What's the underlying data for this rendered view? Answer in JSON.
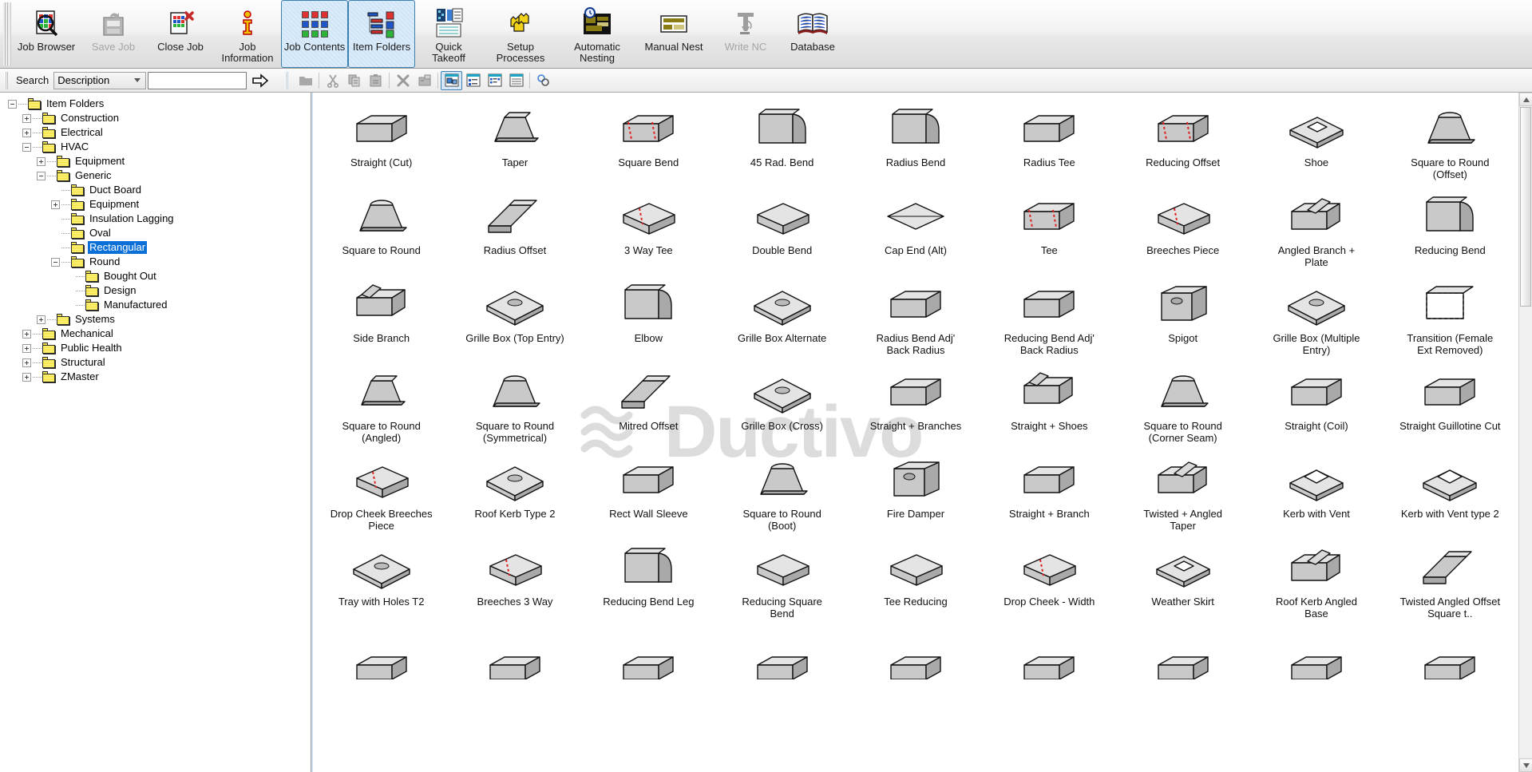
{
  "ribbon": {
    "buttons": [
      {
        "label": "Job Browser",
        "icon": "job-browser-icon",
        "state": "normal"
      },
      {
        "label": "Save Job",
        "icon": "save-job-icon",
        "state": "disabled"
      },
      {
        "label": "Close Job",
        "icon": "close-job-icon",
        "state": "normal"
      },
      {
        "label": "Job\nInformation",
        "icon": "job-information-icon",
        "state": "normal"
      },
      {
        "label": "Job Contents",
        "icon": "job-contents-icon",
        "state": "checked"
      },
      {
        "label": "Item Folders",
        "icon": "item-folders-icon",
        "state": "checked"
      },
      {
        "label": "Quick\nTakeoff",
        "icon": "quick-takeoff-icon",
        "state": "normal"
      },
      {
        "label": "Setup\nProcesses",
        "icon": "setup-processes-icon",
        "state": "normal"
      },
      {
        "label": "Automatic\nNesting",
        "icon": "automatic-nesting-icon",
        "state": "normal"
      },
      {
        "label": "Manual Nest",
        "icon": "manual-nest-icon",
        "state": "normal"
      },
      {
        "label": "Write NC",
        "icon": "write-nc-icon",
        "state": "disabled"
      },
      {
        "label": "Database",
        "icon": "database-icon",
        "state": "normal"
      }
    ]
  },
  "search": {
    "label": "Search",
    "field_selected": "Description",
    "field_options": [
      "Description"
    ],
    "value": "",
    "placeholder": "",
    "go_icon": "arrow-right-icon"
  },
  "toolbar2": {
    "buttons": [
      {
        "icon": "folder-icon",
        "state": "normal"
      },
      {
        "icon": "cut-icon",
        "state": "normal"
      },
      {
        "icon": "copy-icon",
        "state": "normal"
      },
      {
        "icon": "paste-icon",
        "state": "normal"
      },
      {
        "icon": "delete-icon",
        "state": "normal"
      },
      {
        "icon": "properties-icon",
        "state": "normal"
      },
      {
        "icon": "view-large-icons-icon",
        "state": "checked"
      },
      {
        "icon": "view-small-icons-icon",
        "state": "normal"
      },
      {
        "icon": "view-list-icon",
        "state": "normal"
      },
      {
        "icon": "view-details-icon",
        "state": "normal"
      },
      {
        "icon": "view-options-icon",
        "state": "normal"
      }
    ]
  },
  "tree": {
    "root_label": "Item Folders",
    "selected": "Rectangular",
    "nodes": [
      {
        "label": "Item Folders",
        "depth": 0,
        "toggle": "minus"
      },
      {
        "label": "Construction",
        "depth": 1,
        "toggle": "plus"
      },
      {
        "label": "Electrical",
        "depth": 1,
        "toggle": "plus"
      },
      {
        "label": "HVAC",
        "depth": 1,
        "toggle": "minus"
      },
      {
        "label": "Equipment",
        "depth": 2,
        "toggle": "plus"
      },
      {
        "label": "Generic",
        "depth": 2,
        "toggle": "minus"
      },
      {
        "label": "Duct Board",
        "depth": 3,
        "toggle": "none"
      },
      {
        "label": "Equipment",
        "depth": 3,
        "toggle": "plus"
      },
      {
        "label": "Insulation Lagging",
        "depth": 3,
        "toggle": "none"
      },
      {
        "label": "Oval",
        "depth": 3,
        "toggle": "none"
      },
      {
        "label": "Rectangular",
        "depth": 3,
        "toggle": "none",
        "selected": true
      },
      {
        "label": "Round",
        "depth": 3,
        "toggle": "minus"
      },
      {
        "label": "Bought Out",
        "depth": 4,
        "toggle": "none"
      },
      {
        "label": "Design",
        "depth": 4,
        "toggle": "none"
      },
      {
        "label": "Manufactured",
        "depth": 4,
        "toggle": "none"
      },
      {
        "label": "Systems",
        "depth": 2,
        "toggle": "plus"
      },
      {
        "label": "Mechanical",
        "depth": 1,
        "toggle": "plus"
      },
      {
        "label": "Public Health",
        "depth": 1,
        "toggle": "plus"
      },
      {
        "label": "Structural",
        "depth": 1,
        "toggle": "plus"
      },
      {
        "label": "ZMaster",
        "depth": 1,
        "toggle": "plus"
      }
    ]
  },
  "watermark": {
    "text": "Ductivo",
    "icon": "wave-lines-icon"
  },
  "items": [
    {
      "label": "Straight (Cut)",
      "shape": "box"
    },
    {
      "label": "Taper",
      "shape": "taper"
    },
    {
      "label": "Square Bend",
      "shape": "box-seam"
    },
    {
      "label": "45 Rad. Bend",
      "shape": "radbend"
    },
    {
      "label": "Radius Bend",
      "shape": "radbend2"
    },
    {
      "label": "Radius Tee",
      "shape": "box"
    },
    {
      "label": "Reducing Offset",
      "shape": "box-seam"
    },
    {
      "label": "Shoe",
      "shape": "shoe"
    },
    {
      "label": "Square to Round (Offset)",
      "shape": "s2r"
    },
    {
      "label": "Square to Round",
      "shape": "s2r"
    },
    {
      "label": "Radius Offset",
      "shape": "offset"
    },
    {
      "label": "3 Way Tee",
      "shape": "tee3"
    },
    {
      "label": "Double Bend",
      "shape": "dbend"
    },
    {
      "label": "Cap End (Alt)",
      "shape": "cap"
    },
    {
      "label": "Tee",
      "shape": "box-seam"
    },
    {
      "label": "Breeches Piece",
      "shape": "breeches"
    },
    {
      "label": "Angled Branch + Plate",
      "shape": "angbr"
    },
    {
      "label": "Reducing Bend",
      "shape": "rbend"
    },
    {
      "label": "Side Branch",
      "shape": "sidebr"
    },
    {
      "label": "Grille Box (Top Entry)",
      "shape": "gbox"
    },
    {
      "label": "Elbow",
      "shape": "elbow"
    },
    {
      "label": "Grille Box Alternate",
      "shape": "gboxalt"
    },
    {
      "label": "Radius Bend Adj' Back Radius",
      "shape": "box"
    },
    {
      "label": "Reducing Bend Adj' Back Radius",
      "shape": "box"
    },
    {
      "label": "Spigot",
      "shape": "spigot"
    },
    {
      "label": "Grille Box (Multiple Entry)",
      "shape": "gboxm"
    },
    {
      "label": "Transition (Female Ext Removed)",
      "shape": "trans"
    },
    {
      "label": "Square to Round (Angled)",
      "shape": "s2ra"
    },
    {
      "label": "Square to Round (Symmetrical)",
      "shape": "s2rs"
    },
    {
      "label": "Mitred Offset",
      "shape": "mitred"
    },
    {
      "label": "Grille Box (Cross)",
      "shape": "gboxc"
    },
    {
      "label": "Straight + Branches",
      "shape": "strbr"
    },
    {
      "label": "Straight + Shoes",
      "shape": "strsh"
    },
    {
      "label": "Square to Round (Corner Seam)",
      "shape": "s2rc"
    },
    {
      "label": "Straight (Coil)",
      "shape": "coil"
    },
    {
      "label": "Straight Guillotine Cut",
      "shape": "guill"
    },
    {
      "label": "Drop Cheek Breeches Piece",
      "shape": "dcheek"
    },
    {
      "label": "Roof Kerb Type 2",
      "shape": "kerb2"
    },
    {
      "label": "Rect Wall Sleeve",
      "shape": "sleeve"
    },
    {
      "label": "Square to Round (Boot)",
      "shape": "boot"
    },
    {
      "label": "Fire Damper",
      "shape": "damper"
    },
    {
      "label": "Straight + Branch",
      "shape": "strbr"
    },
    {
      "label": "Twisted + Angled Taper",
      "shape": "twist"
    },
    {
      "label": "Kerb with Vent",
      "shape": "kvent"
    },
    {
      "label": "Kerb with Vent type 2",
      "shape": "kvent2"
    },
    {
      "label": "Tray with Holes T2",
      "shape": "tray"
    },
    {
      "label": "Breeches 3 Way",
      "shape": "br3"
    },
    {
      "label": "Reducing Bend Leg",
      "shape": "rbleg"
    },
    {
      "label": "Reducing Square Bend",
      "shape": "rsbend"
    },
    {
      "label": "Tee Reducing",
      "shape": "teered"
    },
    {
      "label": "Drop Cheek - Width",
      "shape": "dcw"
    },
    {
      "label": "Weather Skirt",
      "shape": "skirt"
    },
    {
      "label": "Roof Kerb Angled Base",
      "shape": "kerbang"
    },
    {
      "label": "Twisted Angled Offset Square t..",
      "shape": "twistoff"
    },
    {
      "label": "",
      "shape": "partial"
    },
    {
      "label": "",
      "shape": "partial"
    },
    {
      "label": "",
      "shape": "partial"
    },
    {
      "label": "",
      "shape": "partial"
    },
    {
      "label": "",
      "shape": "partial"
    },
    {
      "label": "",
      "shape": "partial"
    },
    {
      "label": "",
      "shape": "partial"
    },
    {
      "label": "",
      "shape": "partial"
    },
    {
      "label": "",
      "shape": "partial"
    }
  ],
  "scrollbar": {
    "up_icon": "scroll-up-icon",
    "down_icon": "scroll-down-icon",
    "position_pct": 4
  }
}
